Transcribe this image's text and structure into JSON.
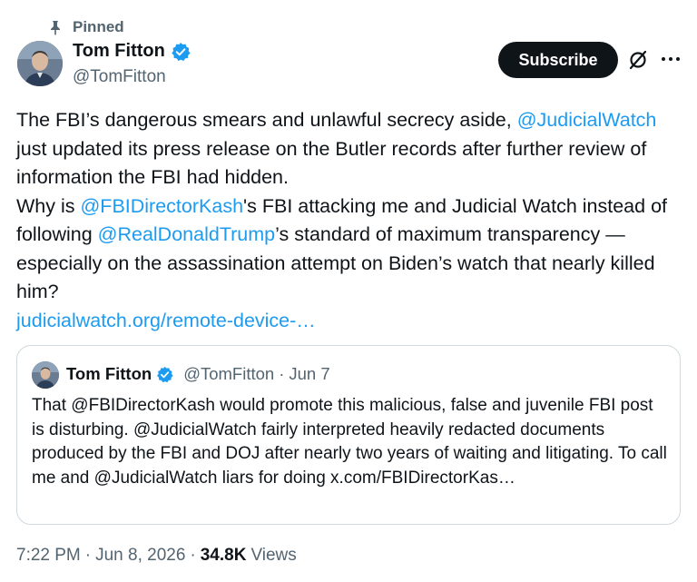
{
  "pinned": {
    "label": "Pinned"
  },
  "author": {
    "display_name": "Tom Fitton",
    "handle": "@TomFitton",
    "verified_color": "#1d9bf0"
  },
  "actions": {
    "subscribe_label": "Subscribe",
    "grok_icon": "grok-icon",
    "more_icon": "more-icon"
  },
  "tweet": {
    "segments": [
      {
        "text": "The FBI’s dangerous smears and unlawful secrecy aside, ",
        "link": false
      },
      {
        "text": "@JudicialWatch",
        "link": true
      },
      {
        "text": " just updated its press release on the Butler records after further review of information the FBI had hidden.",
        "link": false
      },
      {
        "text": "\nWhy is ",
        "link": false
      },
      {
        "text": "@FBIDirectorKash",
        "link": true
      },
      {
        "text": "'s FBI attacking me and Judicial Watch instead of following ",
        "link": false
      },
      {
        "text": "@RealDonaldTrump",
        "link": true
      },
      {
        "text": "’s standard of maximum transparency — especially on the assassination attempt on Biden’s watch that nearly killed him?",
        "link": false
      },
      {
        "text": "\n",
        "link": false
      },
      {
        "text": "judicialwatch.org/remote-device-…",
        "link": true
      }
    ]
  },
  "quote": {
    "display_name": "Tom Fitton",
    "handle": "@TomFitton",
    "separator": "·",
    "date": "Jun 7",
    "text": "That @FBIDirectorKash would promote this malicious, false and juvenile FBI post is disturbing. @JudicialWatch fairly interpreted heavily redacted documents produced by the FBI and DOJ after nearly two years of waiting and litigating. To call me and @JudicialWatch liars for doing x.com/FBIDirectorKas…"
  },
  "meta": {
    "time": "7:22 PM",
    "sep1": "·",
    "date": "Jun 8, 2026",
    "sep2": "·",
    "views_count": "34.8K",
    "views_label": "Views"
  },
  "colors": {
    "text": "#0f1419",
    "secondary": "#536471",
    "link": "#1d9bf0",
    "border": "#cfd9de"
  }
}
